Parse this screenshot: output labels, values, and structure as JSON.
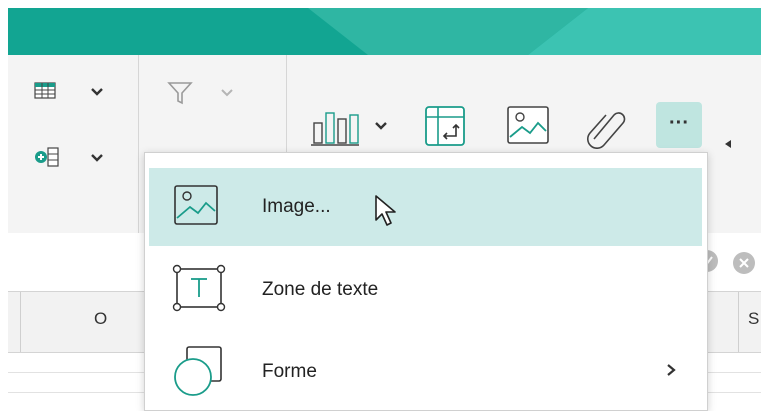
{
  "colors": {
    "teal": "#12a592",
    "teal_light": "#3cc3b2",
    "menu_highlight": "#cdeae8",
    "icon_green": "#1a9c8a"
  },
  "ribbon": {
    "table_btn_icon": "table-insert-icon",
    "columns_btn_icon": "insert-column-icon",
    "filter_icon": "filter-icon",
    "chart_icon": "bar-chart-icon",
    "pivot_icon": "pivot-table-icon",
    "image_icon": "image-icon",
    "link_icon": "link-icon",
    "more_label": "···",
    "collapse_icon": "triangle-left-icon"
  },
  "sheet": {
    "columns": [
      "O",
      "S"
    ]
  },
  "menu": {
    "items": [
      {
        "label": "Image...",
        "icon": "image-icon",
        "highlighted": true
      },
      {
        "label": "Zone de texte",
        "icon": "text-box-icon",
        "highlighted": false
      },
      {
        "label": "Forme",
        "icon": "shape-icon",
        "highlighted": false,
        "submenu": "›"
      }
    ]
  }
}
